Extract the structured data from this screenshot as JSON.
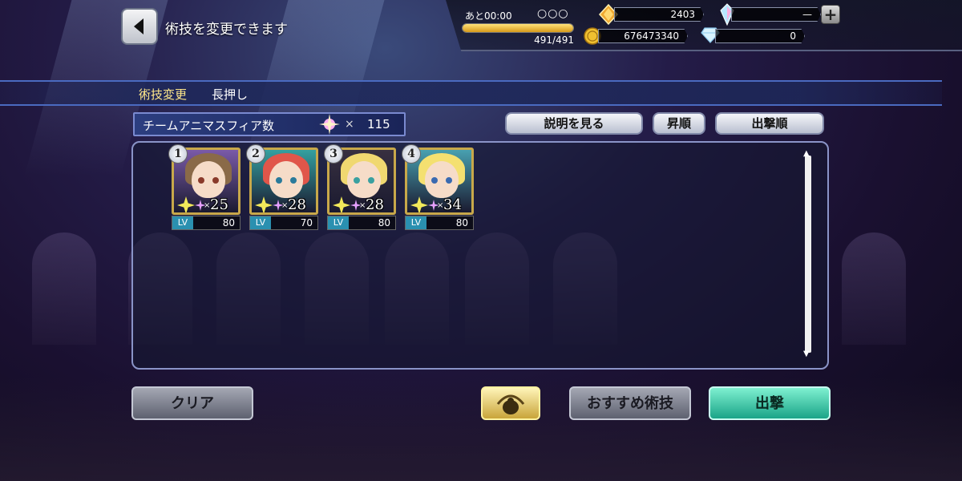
{
  "header": {
    "title": "術技を変更できます"
  },
  "stamina": {
    "label": "あと00:00",
    "circles": "○○○",
    "value": "491/491",
    "fill_fraction": 1.0
  },
  "resources": {
    "gald": "2403",
    "crystal": "—",
    "money": "676473340",
    "diamond": "0"
  },
  "section": {
    "title": "術技変更",
    "hint": "長押し"
  },
  "team": {
    "label": "チームアニマスフィア数",
    "times": "×",
    "value": "115"
  },
  "controls": {
    "explain": "説明を見る",
    "ascending": "昇順",
    "sortie_order": "出撃順"
  },
  "characters": [
    {
      "order": "1",
      "count": "25",
      "times": "×",
      "lv_label": "LV",
      "level": "80",
      "hair": "#8a6a48",
      "bg": "#7a5aa8",
      "eye": "#8a3a2a"
    },
    {
      "order": "2",
      "count": "28",
      "times": "×",
      "lv_label": "LV",
      "level": "70",
      "hair": "#e0564a",
      "bg": "#34a0a0",
      "eye": "#2a7a9a"
    },
    {
      "order": "3",
      "count": "28",
      "times": "×",
      "lv_label": "LV",
      "level": "80",
      "hair": "#f0d870",
      "bg": "#383040",
      "eye": "#3aa0a0"
    },
    {
      "order": "4",
      "count": "34",
      "times": "×",
      "lv_label": "LV",
      "level": "80",
      "hair": "#f4e070",
      "bg": "#48a0b0",
      "eye": "#3a6ab0"
    }
  ],
  "buttons": {
    "clear": "クリア",
    "recommend": "おすすめ術技",
    "sortie": "出撃"
  }
}
